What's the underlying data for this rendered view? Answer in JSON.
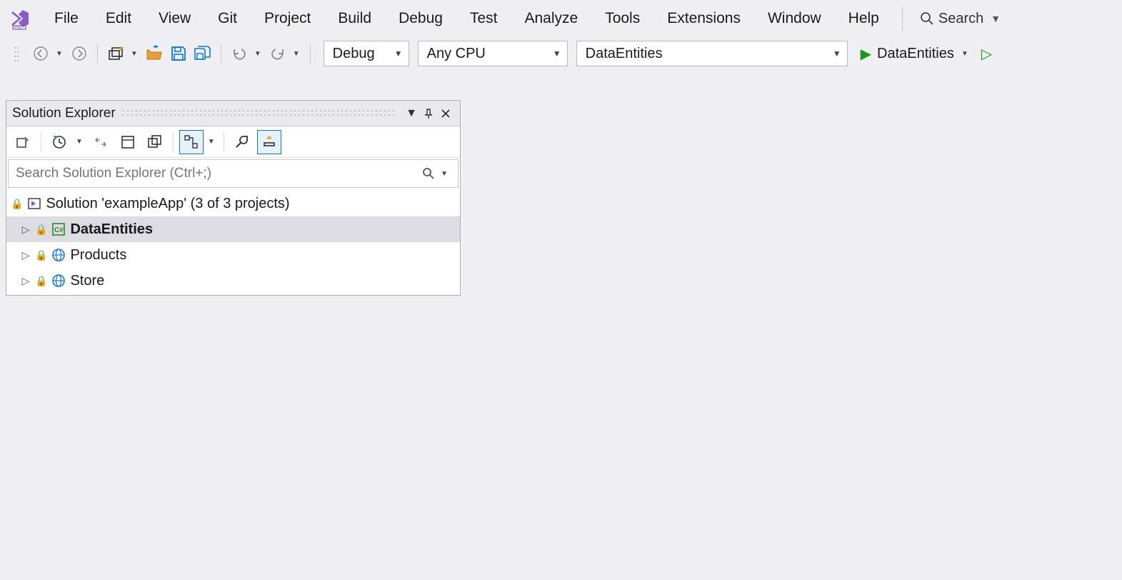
{
  "menu": {
    "items": [
      "File",
      "Edit",
      "View",
      "Git",
      "Project",
      "Build",
      "Debug",
      "Test",
      "Analyze",
      "Tools",
      "Extensions",
      "Window",
      "Help"
    ],
    "search_label": "Search"
  },
  "toolbar": {
    "config": "Debug",
    "platform": "Any CPU",
    "startup_project": "DataEntities",
    "run_label": "DataEntities"
  },
  "solution_explorer": {
    "title": "Solution Explorer",
    "search_placeholder": "Search Solution Explorer (Ctrl+;)",
    "root_label": "Solution 'exampleApp' (3 of 3 projects)",
    "projects": [
      {
        "name": "DataEntities",
        "selected": true,
        "type": "csharp"
      },
      {
        "name": "Products",
        "selected": false,
        "type": "web"
      },
      {
        "name": "Store",
        "selected": false,
        "type": "web"
      }
    ]
  }
}
